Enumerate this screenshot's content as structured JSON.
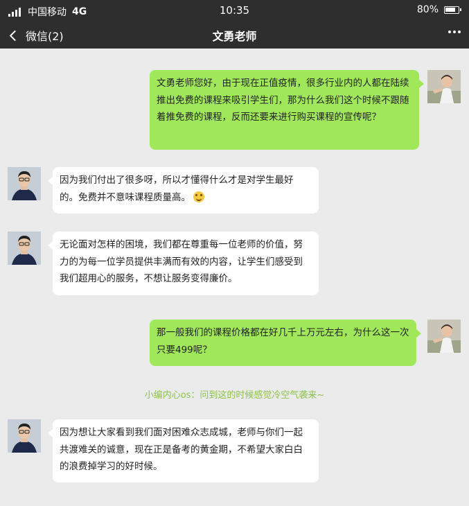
{
  "status_bar": {
    "carrier": "中国移动",
    "network": "4G",
    "time": "10:35",
    "battery": "80%",
    "battery_level": 0.8
  },
  "nav": {
    "back_label": "微信(2)",
    "title": "文勇老师",
    "more_icon": "more-dots-icon"
  },
  "colors": {
    "outgoing_bubble": "#a0e75a",
    "incoming_bubble": "#ffffff",
    "note_text": "#8cc34a",
    "bar": "#2e2e2e"
  },
  "messages": [
    {
      "side": "out",
      "text": "文勇老师您好，由于现在正值疫情，很多行业内的人都在陆续推出免费的课程来吸引学生们，那为什么我们这个时候不跟随着推免费的课程，反而还要来进行购买课程的宣传呢？"
    },
    {
      "side": "in",
      "text": "因为我们付出了很多呀，所以才懂得什么才是对学生最好的。免费并不意味课程质量高。",
      "emoji": "smile-emoji"
    },
    {
      "side": "in",
      "text": "无论面对怎样的困境，我们都在尊重每一位老师的价值，努力的为每一位学员提供丰满而有效的内容，让学生们感受到我们超用心的服务，不想让服务变得廉价。"
    },
    {
      "side": "out",
      "text": "那一般我们的课程价格都在好几千上万元左右，为什么这一次只要499呢？"
    },
    {
      "side": "in",
      "text": "因为想让大家看到我们面对困难众志成城，老师与你们一起共渡难关的诚意，现在正是备考的黄金期，不希望大家白白的浪费掉学习的好时候。"
    }
  ],
  "system_note": "小编内心os：问到这的时候感觉冷空气袭来~"
}
